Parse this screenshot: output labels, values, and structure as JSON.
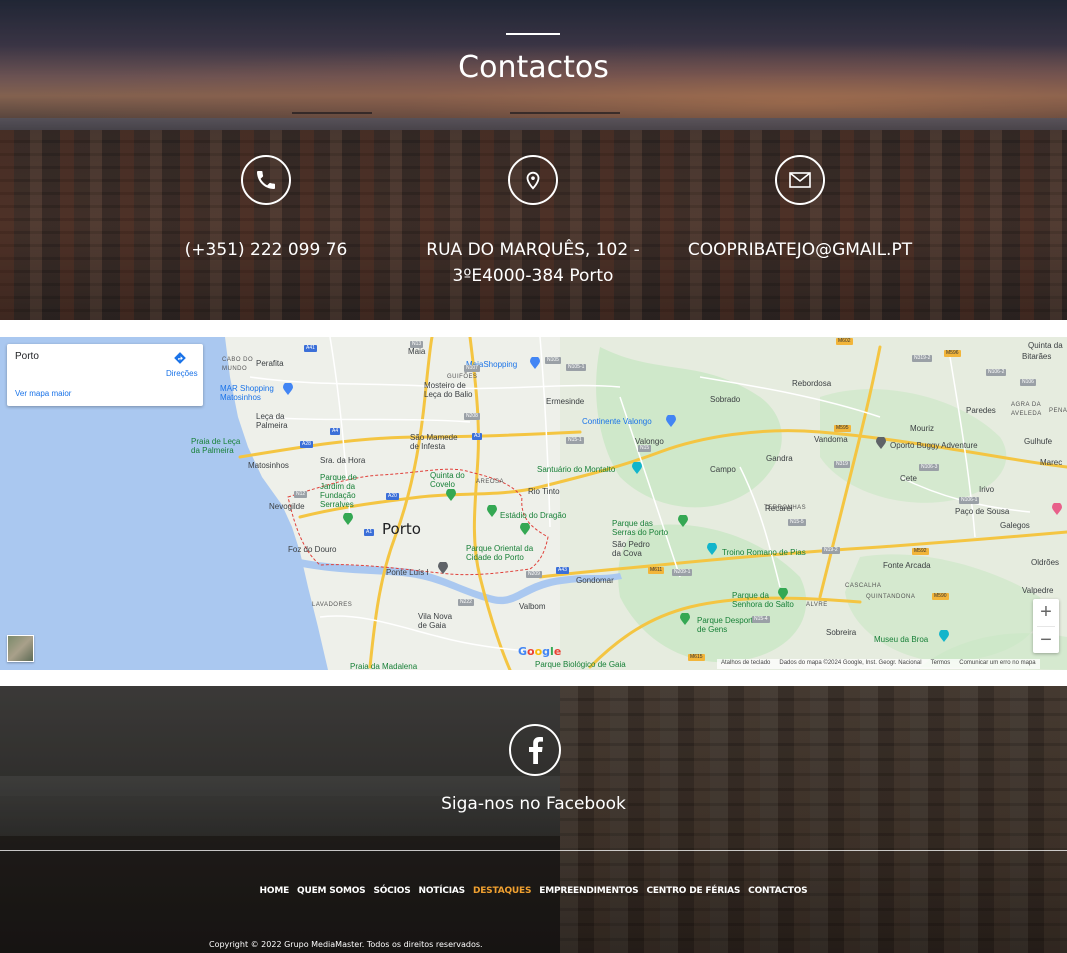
{
  "contacts": {
    "title": "Contactos",
    "phone": "(+351) 222 099 76",
    "address_line1": "RUA DO MARQUÊS, 102 -",
    "address_line2": "3ºE4000-384 Porto",
    "email": "COOPRIBATEJO@GMAIL.PT",
    "icons": [
      "phone-icon",
      "location-pin-icon",
      "envelope-icon"
    ]
  },
  "map": {
    "card": {
      "place": "Porto",
      "directions": "Direções",
      "larger_map": "Ver mapa maior"
    },
    "zoom_in": "+",
    "zoom_out": "−",
    "footer": {
      "shortcuts": "Atalhos de teclado",
      "data": "Dados do mapa ©2024 Google, Inst. Geogr. Nacional",
      "terms": "Termos",
      "report": "Comunicar um erro no mapa"
    },
    "labels": {
      "porto": "Porto",
      "perafita": "Perafita",
      "maia": "Maia",
      "bitaraes": "Bitarães",
      "rebordosa": "Rebordosa",
      "sobrado": "Sobrado",
      "ermesinde": "Ermesinde",
      "leca_palmeira": "Leça da\nPalmeira",
      "sao_mamede": "São Mamede\nde Infesta",
      "matosinhos": "Matosinhos",
      "sra_hora": "Sra. da Hora",
      "valongo": "Valongo",
      "campo": "Campo",
      "gandra": "Gandra",
      "vandoma": "Vandoma",
      "mouriz": "Mouriz",
      "paredes": "Paredes",
      "gulhufe": "Gulhufe",
      "marecos": "Marec",
      "cete": "Cete",
      "irivo": "Irivo",
      "paco_sousa": "Paço de Sousa",
      "galegos": "Galegos",
      "recarei": "Recarei",
      "fonte_arcada": "Fonte Arcada",
      "oldroes": "Oldrões",
      "valpedre": "Valpedre",
      "nevogilde": "Nevogilde",
      "rio_tinto": "Rio Tinto",
      "foz_douro": "Foz do Douro",
      "sao_pedro_cova": "São Pedro\nda Cova",
      "gondomar": "Gondomar",
      "valbom": "Valbom",
      "vila_nova_gaia": "Vila Nova\nde Gaia",
      "sobreira": "Sobreira",
      "quinta_da": "Quinta da",
      "mosteiro_leca": "Mosteiro de\nLeça do Balio",
      "maiashopping": "MaiaShopping",
      "mar_shopping": "MAR Shopping\nMatosinhos",
      "praia_leca": "Praia de Leça\nda Palmeira",
      "parque_serralves": "Parque de\nJardim da\nFundação\nSerralves",
      "quinta_covelo": "Quinta do\nCovelo",
      "estadio_dragao": "Estádio do Dragão",
      "parque_oriental": "Parque Oriental da\nCidade do Porto",
      "ponte_luis": "Ponte Luís I",
      "continente_valongo": "Continente Valongo",
      "santuario_montalto": "Santuário do Montalto",
      "parque_serras": "Parque das\nSerras do Porto",
      "troino_romano": "Troino Romano de Pias",
      "oporto_buggy": "Oporto Buggy Adventure",
      "parque_senhora_salto": "Parque da\nSenhora do Salto",
      "parque_desportivo_gens": "Parque Desportivo\nde Gens",
      "museu_broa": "Museu da Broa",
      "praia_madalena": "Praia da Madalena",
      "parque_biologico": "Parque Biológico de Gaia",
      "lavadores": "LAVADORES",
      "cabo_mundo": "CABO DO\nMUNDO",
      "guifoes": "GUIFÕES",
      "areosa": "AREOSA",
      "terronhas": "TERRONHAS",
      "cascalha": "CASCALHA",
      "quintandona": "QUINTANDONA",
      "alvre": "ALVRE",
      "agra_avelada": "AGRA DA\nAVELEDA",
      "pena": "PENA"
    },
    "roads": [
      "A41",
      "N13",
      "N107",
      "N105",
      "N105-1",
      "A4",
      "A28",
      "N12",
      "A20",
      "A1",
      "A3",
      "N15",
      "N15-1",
      "N208",
      "A43",
      "N209",
      "N209-1",
      "N222",
      "M611",
      "M615",
      "N319",
      "M596",
      "N106-2",
      "N106",
      "N106-3",
      "N106-1",
      "M595",
      "M590",
      "N19-2",
      "M592",
      "N15-5",
      "N15-4",
      "M602",
      "N319-2"
    ],
    "colors": {
      "water": "#aac8f0",
      "land": "#eef0ea",
      "park": "#c9e7c4",
      "highway": "#f4c542",
      "road": "#ffffff",
      "boundary": "#e0403a"
    }
  },
  "footer": {
    "facebook_text": "Siga-nos no Facebook",
    "facebook_icon": "facebook-icon",
    "nav": [
      {
        "label": "HOME",
        "active": false
      },
      {
        "label": "QUEM SOMOS",
        "active": false
      },
      {
        "label": "SÓCIOS",
        "active": false
      },
      {
        "label": "NOTÍCIAS",
        "active": false
      },
      {
        "label": "DESTAQUES",
        "active": true
      },
      {
        "label": "EMPREENDIMENTOS",
        "active": false
      },
      {
        "label": "CENTRO DE FÉRIAS",
        "active": false
      },
      {
        "label": "CONTACTOS",
        "active": false
      }
    ],
    "copyright": "Copyright © 2022 Grupo MediaMaster. Todos os direitos reservados.",
    "active_color": "#f0a030"
  }
}
